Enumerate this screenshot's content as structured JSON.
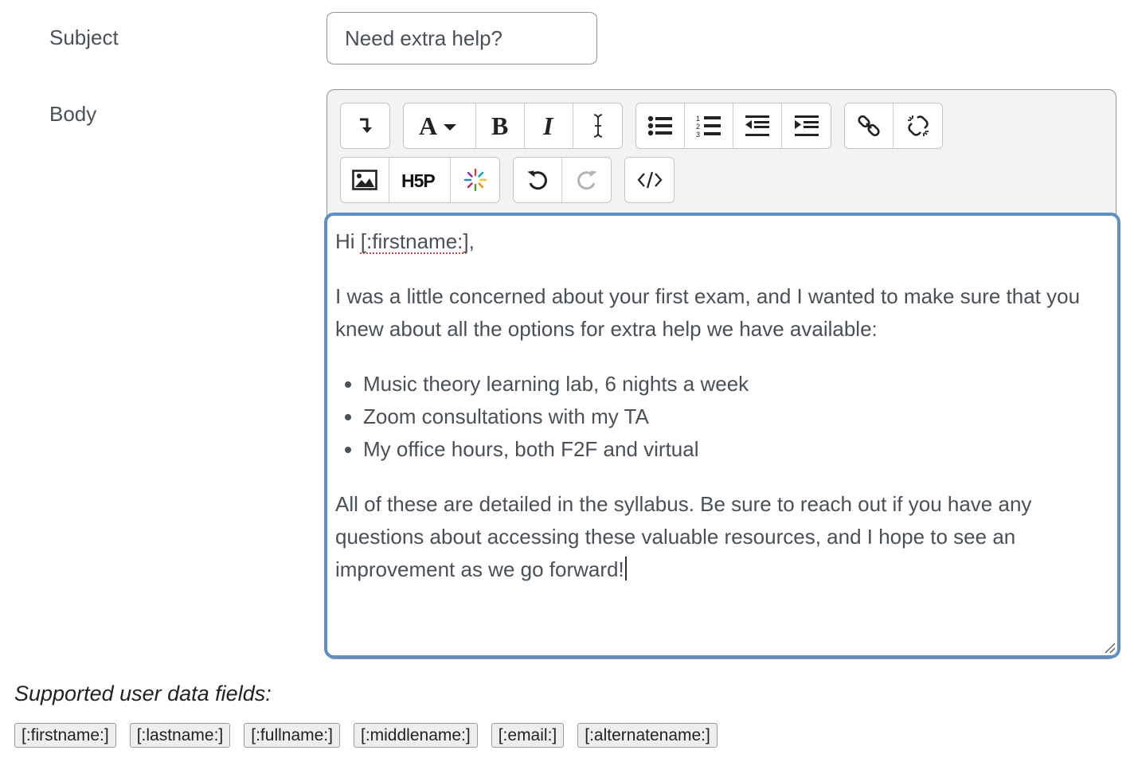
{
  "form": {
    "subject_label": "Subject",
    "subject_value": "Need extra help?",
    "body_label": "Body"
  },
  "toolbar": {
    "row1": [
      {
        "group": "collapse",
        "items": [
          "collapse-icon"
        ]
      },
      {
        "group": "text",
        "items": [
          "font-style-icon",
          "bold-icon",
          "italic-icon",
          "clear-format-icon"
        ]
      },
      {
        "group": "list",
        "items": [
          "bullet-list-icon",
          "numbered-list-icon",
          "outdent-icon",
          "indent-icon"
        ]
      },
      {
        "group": "links",
        "items": [
          "link-icon",
          "unlink-icon"
        ]
      }
    ],
    "row2": [
      {
        "group": "media",
        "items": [
          "image-icon",
          "h5p-icon",
          "accessibility-icon"
        ]
      },
      {
        "group": "history",
        "items": [
          "undo-icon",
          "redo-icon"
        ]
      },
      {
        "group": "source",
        "items": [
          "html-source-icon"
        ]
      }
    ]
  },
  "editor": {
    "greeting_prefix": "Hi ",
    "greeting_token": "[:firstname:]",
    "greeting_suffix": ",",
    "paragraph1": "I was a little concerned about your first exam, and I wanted to make sure that you knew about all the options for extra help we have available:",
    "bullets": [
      "Music theory learning lab, 6 nights a week",
      "Zoom consultations with my TA",
      "My office hours, both F2F and virtual"
    ],
    "paragraph2": "All of these are detailed in the syllabus. Be sure to reach out if you have any questions about accessing these valuable resources, and I hope to see an improvement as we go forward!"
  },
  "fields": {
    "title": "Supported user data fields:",
    "chips": [
      "[:firstname:]",
      "[:lastname:]",
      "[:fullname:]",
      "[:middlename:]",
      "[:email:]",
      "[:alternatename:]"
    ]
  },
  "colors": {
    "focus_border": "#5f8fc9",
    "spellcheck": "#e0443c",
    "toolbar_bg": "#f3f3f3"
  }
}
